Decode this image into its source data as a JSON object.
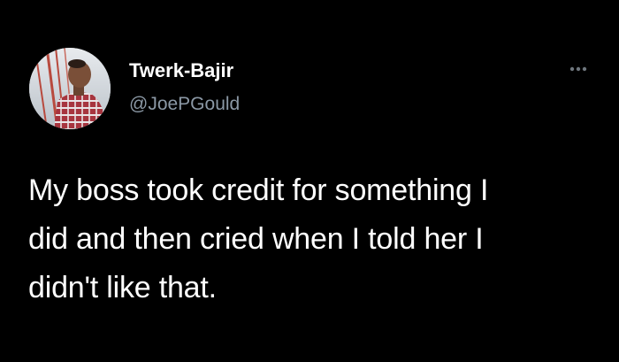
{
  "tweet": {
    "author": {
      "display_name": "Twerk-Bajir",
      "handle": "@JoePGould",
      "avatar_icon": "user-avatar-photo"
    },
    "more_icon": "more-horizontal-icon",
    "text_lines": [
      "My boss took credit for something I",
      "did and then cried when I told her I",
      "didn't like that."
    ]
  },
  "colors": {
    "background": "#000000",
    "primary_text": "#ffffff",
    "secondary_text": "#8b98a5",
    "more_icon": "#6e767d"
  }
}
